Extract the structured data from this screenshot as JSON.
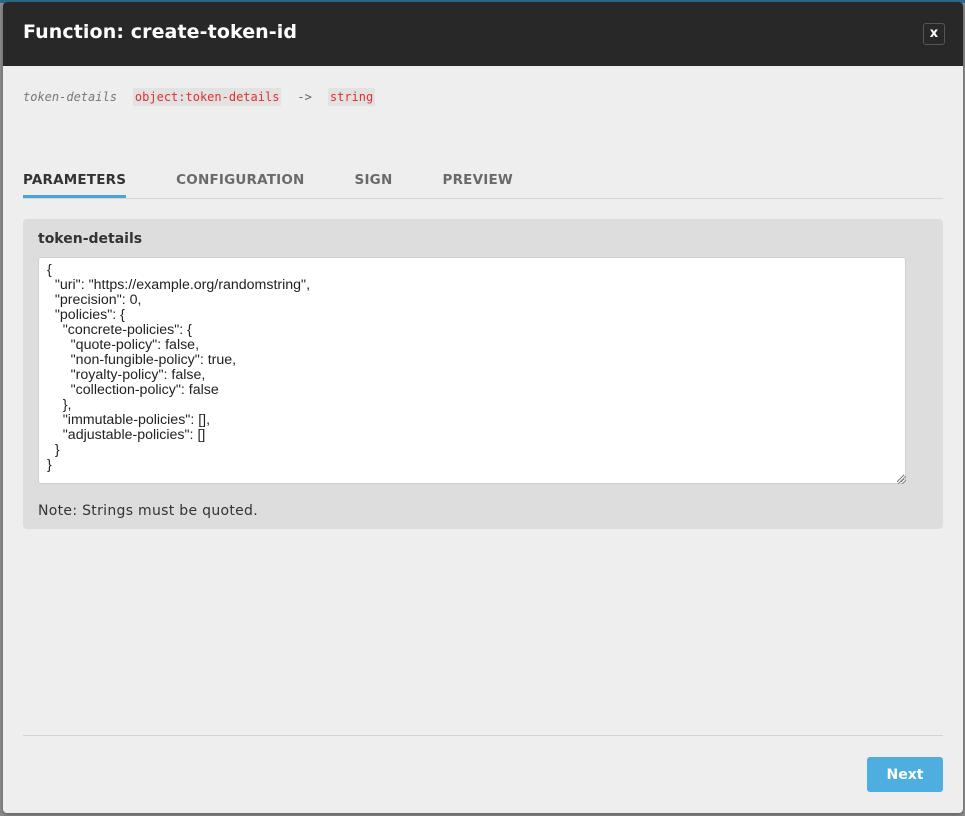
{
  "modal": {
    "title": "Function: create-token-id",
    "close_label": "x"
  },
  "signature": {
    "param_name": "token-details",
    "param_type": "object:token-details",
    "arrow": "->",
    "return_type": "string"
  },
  "tabs": [
    {
      "label": "PARAMETERS",
      "active": true
    },
    {
      "label": "CONFIGURATION",
      "active": false
    },
    {
      "label": "SIGN",
      "active": false
    },
    {
      "label": "PREVIEW",
      "active": false
    }
  ],
  "parameters": {
    "label": "token-details",
    "value": "{\n  \"uri\": \"https://example.org/randomstring\",\n  \"precision\": 0,\n  \"policies\": {\n    \"concrete-policies\": {\n      \"quote-policy\": false,\n      \"non-fungible-policy\": true,\n      \"royalty-policy\": false,\n      \"collection-policy\": false\n    },\n    \"immutable-policies\": [],\n    \"adjustable-policies\": []\n  }\n}",
    "note": "Note: Strings must be quoted."
  },
  "footer": {
    "next_label": "Next"
  },
  "colors": {
    "header_bg": "#282828",
    "accent": "#4aa4d9",
    "type_red": "#e0302f",
    "button_bg": "#4eaee0"
  }
}
